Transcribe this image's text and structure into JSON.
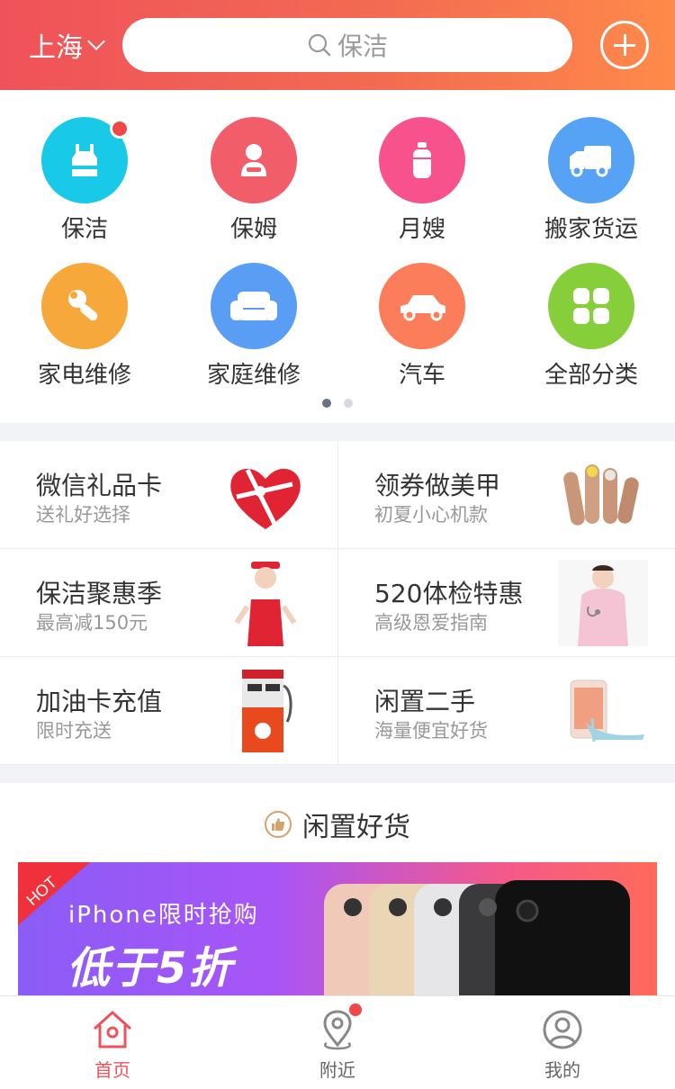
{
  "header": {
    "city": "上海",
    "search_placeholder": "保洁"
  },
  "categories": [
    {
      "label": "保洁",
      "color": "#19c9e8",
      "icon": "cleaning-icon",
      "badge": true
    },
    {
      "label": "保姆",
      "color": "#f25d6a",
      "icon": "nanny-icon"
    },
    {
      "label": "月嫂",
      "color": "#f7528b",
      "icon": "baby-bottle-icon"
    },
    {
      "label": "搬家货运",
      "color": "#56a3f5",
      "icon": "truck-icon"
    },
    {
      "label": "家电维修",
      "color": "#f7a83a",
      "icon": "wrench-icon"
    },
    {
      "label": "家庭维修",
      "color": "#5a9df5",
      "icon": "sofa-icon"
    },
    {
      "label": "汽车",
      "color": "#fb7d5a",
      "icon": "car-icon"
    },
    {
      "label": "全部分类",
      "color": "#86cf3a",
      "icon": "grid-icon"
    }
  ],
  "promos": [
    {
      "title": "微信礼品卡",
      "subtitle": "送礼好选择",
      "image": "gift-heart-image"
    },
    {
      "title": "领券做美甲",
      "subtitle": "初夏小心机款",
      "image": "manicure-image"
    },
    {
      "title": "保洁聚惠季",
      "subtitle": "最高减150元",
      "image": "cleaner-woman-image"
    },
    {
      "title": "520体检特惠",
      "subtitle": "高级恩爱指南",
      "image": "nurse-image"
    },
    {
      "title": "加油卡充值",
      "subtitle": "限时充送",
      "image": "gas-pump-image"
    },
    {
      "title": "闲置二手",
      "subtitle": "海量便宜好货",
      "image": "phone-heels-image"
    }
  ],
  "section": {
    "title": "闲置好货",
    "banner": {
      "hot": "HOT",
      "line1": "iPhone限时抢购",
      "line2": "低于5折"
    }
  },
  "tabbar": [
    {
      "label": "首页",
      "icon": "home-icon",
      "active": true
    },
    {
      "label": "附近",
      "icon": "location-icon",
      "badge": true
    },
    {
      "label": "我的",
      "icon": "user-icon"
    }
  ],
  "colors": {
    "accent": "#f0525a",
    "header_gradient_end": "#ff8a4a"
  }
}
